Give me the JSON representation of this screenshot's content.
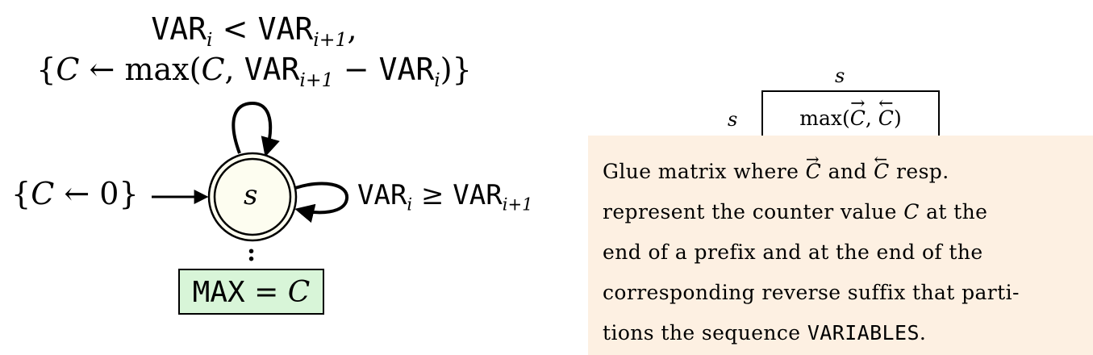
{
  "automaton": {
    "loop_guard": {
      "var": "VAR",
      "op": "<",
      "sub_i": "i",
      "sub_i1": "i+1",
      "suffix": ","
    },
    "loop_action": {
      "open": "{",
      "lhs": "C",
      "arrow": "←",
      "fn": "max(",
      "arg1": "C",
      "comma": ",",
      "var": "VAR",
      "sub_i1": "i+1",
      "minus": "−",
      "sub_i": "i",
      "close": ")}"
    },
    "init": {
      "open": "{",
      "lhs": "C",
      "arrow": "←",
      "value": "0",
      "close": "}"
    },
    "state": {
      "name": "s"
    },
    "self_loop_right": {
      "var": "VAR",
      "op": "≥",
      "sub_i": "i",
      "sub_i1": "i+1"
    },
    "final_dots": ":",
    "final": {
      "var": "MAX",
      "eq": "=",
      "value": "C"
    }
  },
  "glue_matrix": {
    "col_label": "s",
    "row_label": "s",
    "cell": {
      "fn": "max(",
      "arg1": "C",
      "arg1_arrow": "→",
      "comma": ",",
      "arg2": "C",
      "arg2_arrow": "←",
      "close": ")"
    }
  },
  "caption": {
    "line1_a": "Glue matrix where",
    "line1_c1": "C",
    "line1_b": "and",
    "line1_c2": "C",
    "line1_c": "resp.",
    "line2_a": "represent the counter value",
    "line2_c": "C",
    "line2_b": "at the",
    "line3": "end of a prefix and at the end of the",
    "line4": "corresponding reverse suffix that parti-",
    "line5_a": "tions the sequence",
    "line5_var": "VARIABLES",
    "line5_b": "."
  },
  "colors": {
    "state_fill": "#fdfdf0",
    "final_fill": "#d8f5d8",
    "caption_bg": "#fdf0e2"
  }
}
